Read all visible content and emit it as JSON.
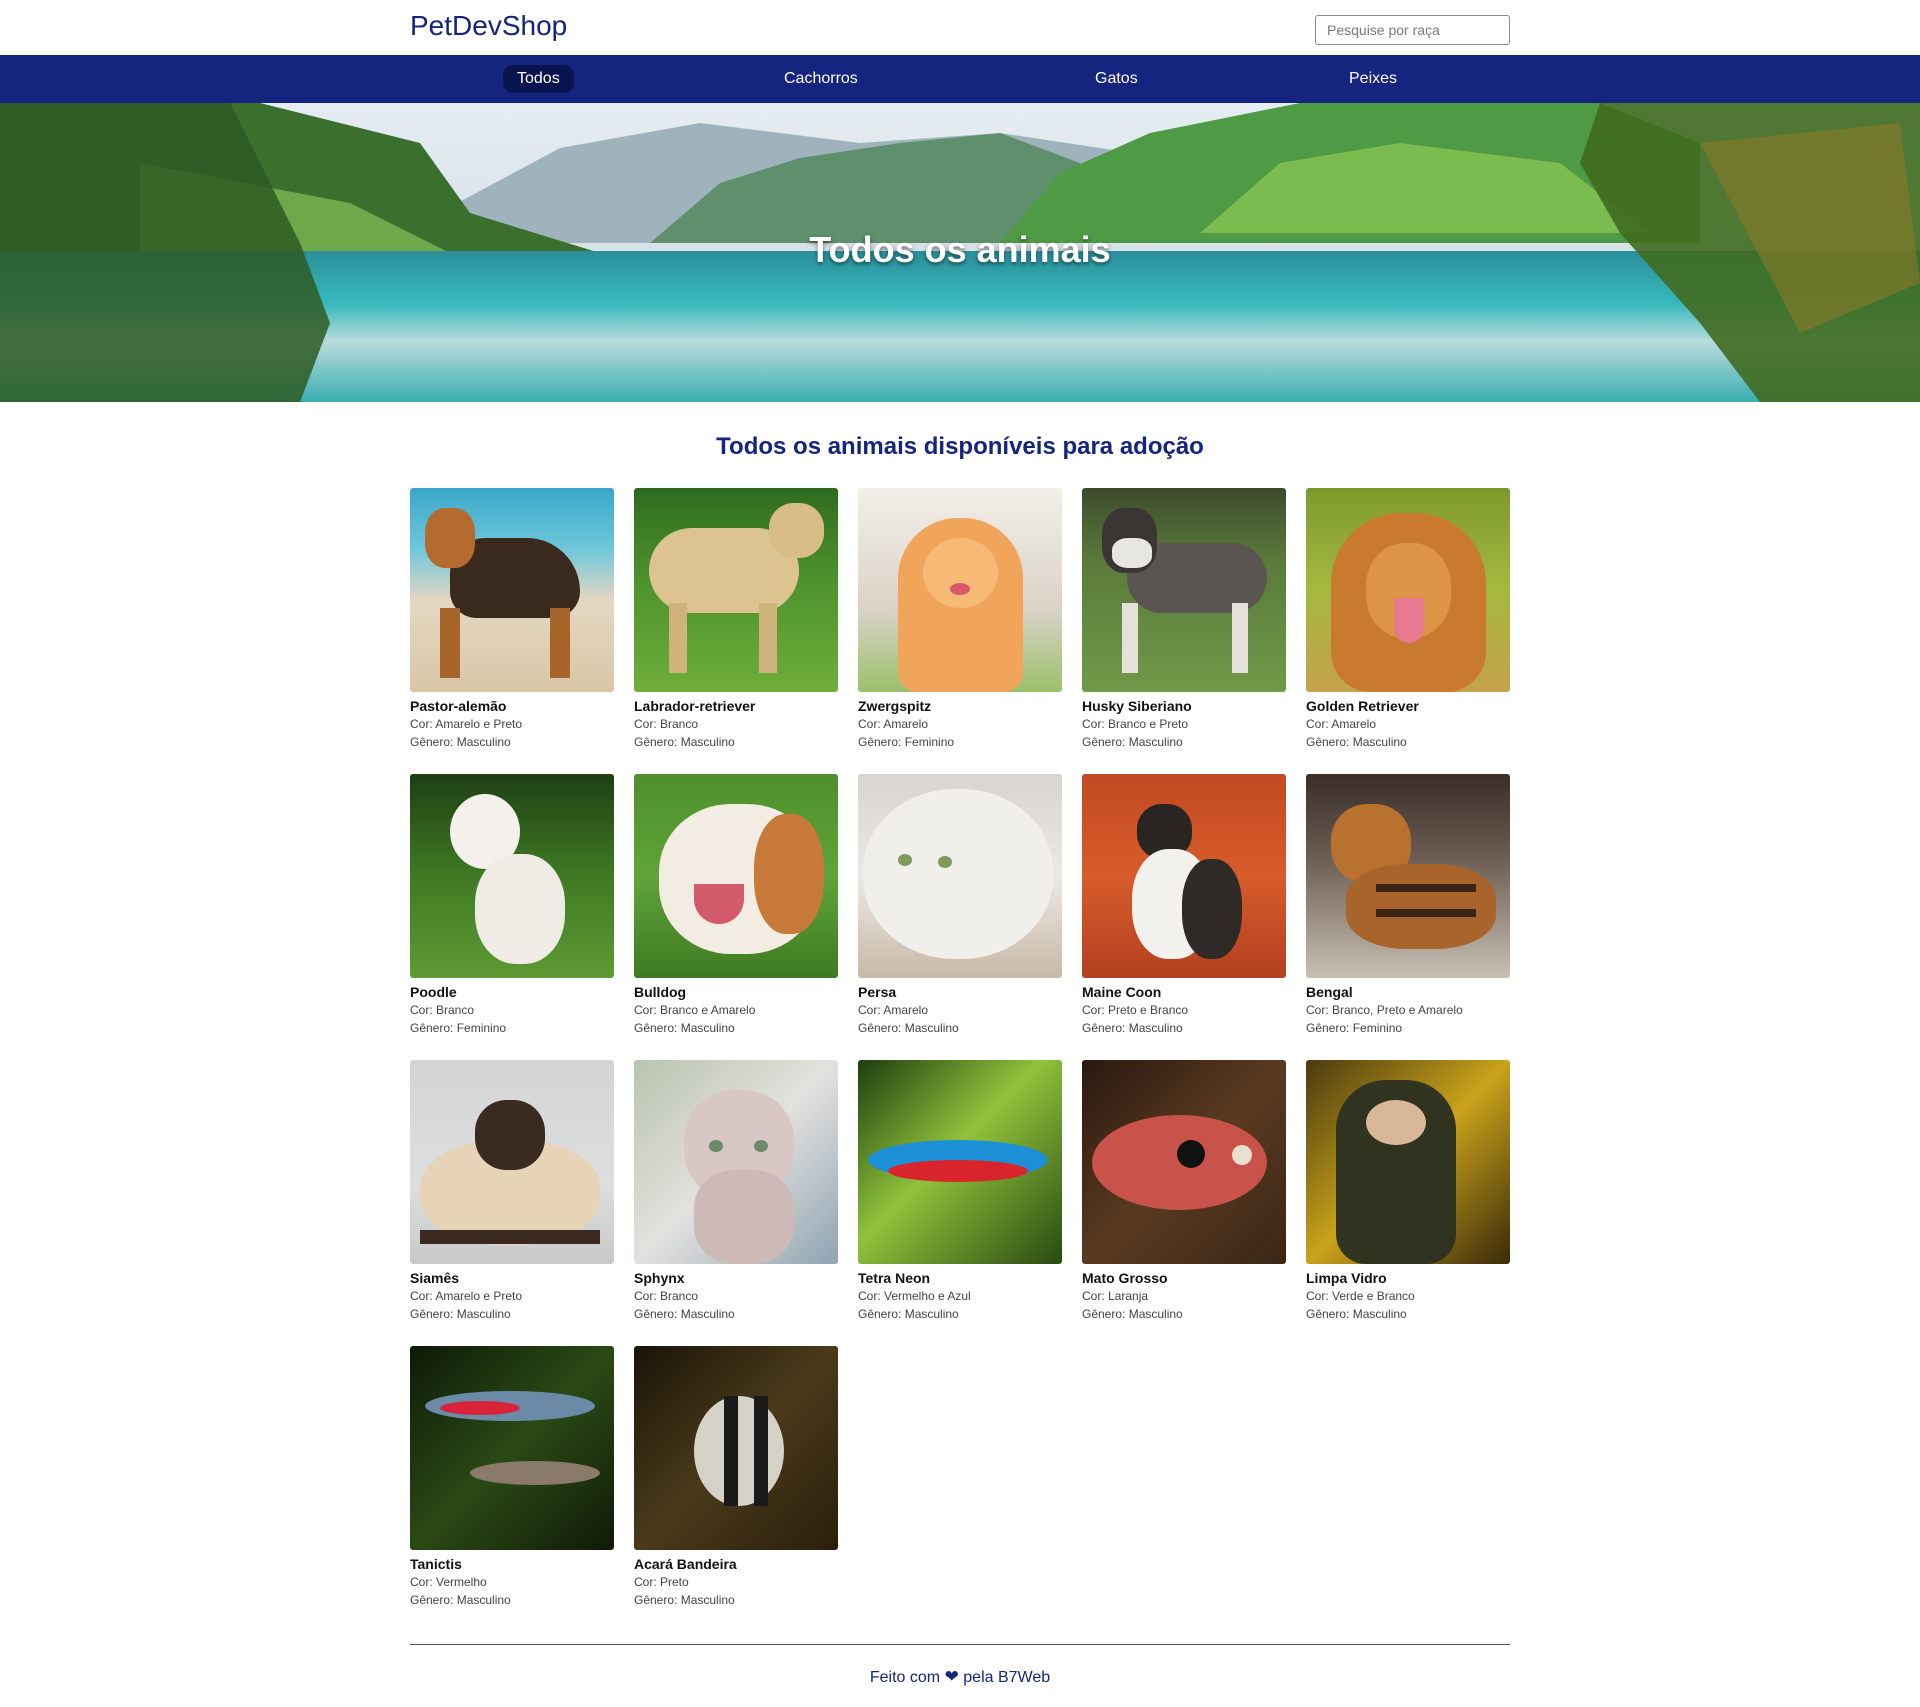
{
  "header": {
    "logo": "PetDevShop",
    "search_placeholder": "Pesquise por raça"
  },
  "nav": {
    "items": [
      {
        "label": "Todos",
        "active": true
      },
      {
        "label": "Cachorros",
        "active": false
      },
      {
        "label": "Gatos",
        "active": false
      },
      {
        "label": "Peixes",
        "active": false
      }
    ]
  },
  "banner": {
    "title": "Todos os animais"
  },
  "section": {
    "title": "Todos os animais disponíveis para adoção"
  },
  "animals": [
    {
      "name": "Pastor-alemão",
      "color": "Cor: Amarelo e Preto",
      "gender": "Gênero: Masculino"
    },
    {
      "name": "Labrador-retriever",
      "color": "Cor: Branco",
      "gender": "Gênero: Masculino"
    },
    {
      "name": "Zwergspitz",
      "color": "Cor: Amarelo",
      "gender": "Gênero: Feminino"
    },
    {
      "name": "Husky Siberiano",
      "color": "Cor: Branco e Preto",
      "gender": "Gênero: Masculino"
    },
    {
      "name": "Golden Retriever",
      "color": "Cor: Amarelo",
      "gender": "Gênero: Masculino"
    },
    {
      "name": "Poodle",
      "color": "Cor: Branco",
      "gender": "Gênero: Feminino"
    },
    {
      "name": "Bulldog",
      "color": "Cor: Branco e Amarelo",
      "gender": "Gênero: Masculino"
    },
    {
      "name": "Persa",
      "color": "Cor: Amarelo",
      "gender": "Gênero: Masculino"
    },
    {
      "name": "Maine Coon",
      "color": "Cor: Preto e Branco",
      "gender": "Gênero: Masculino"
    },
    {
      "name": "Bengal",
      "color": "Cor: Branco, Preto e Amarelo",
      "gender": "Gênero: Feminino"
    },
    {
      "name": "Siamês",
      "color": "Cor: Amarelo e Preto",
      "gender": "Gênero: Masculino"
    },
    {
      "name": "Sphynx",
      "color": "Cor: Branco",
      "gender": "Gênero: Masculino"
    },
    {
      "name": "Tetra Neon",
      "color": "Cor: Vermelho e Azul",
      "gender": "Gênero: Masculino"
    },
    {
      "name": "Mato Grosso",
      "color": "Cor: Laranja",
      "gender": "Gênero: Masculino"
    },
    {
      "name": "Limpa Vidro",
      "color": "Cor: Verde e Branco",
      "gender": "Gênero: Masculino"
    },
    {
      "name": "Tanictis",
      "color": "Cor: Vermelho",
      "gender": "Gênero: Masculino"
    },
    {
      "name": "Acará Bandeira",
      "color": "Cor: Preto",
      "gender": "Gênero: Masculino"
    }
  ],
  "footer": {
    "text_before": "Feito com",
    "heart_icon": "heart-icon",
    "text_after": "pela B7Web"
  },
  "colors": {
    "brand": "#14247f",
    "nav_active": "#0a1550"
  }
}
